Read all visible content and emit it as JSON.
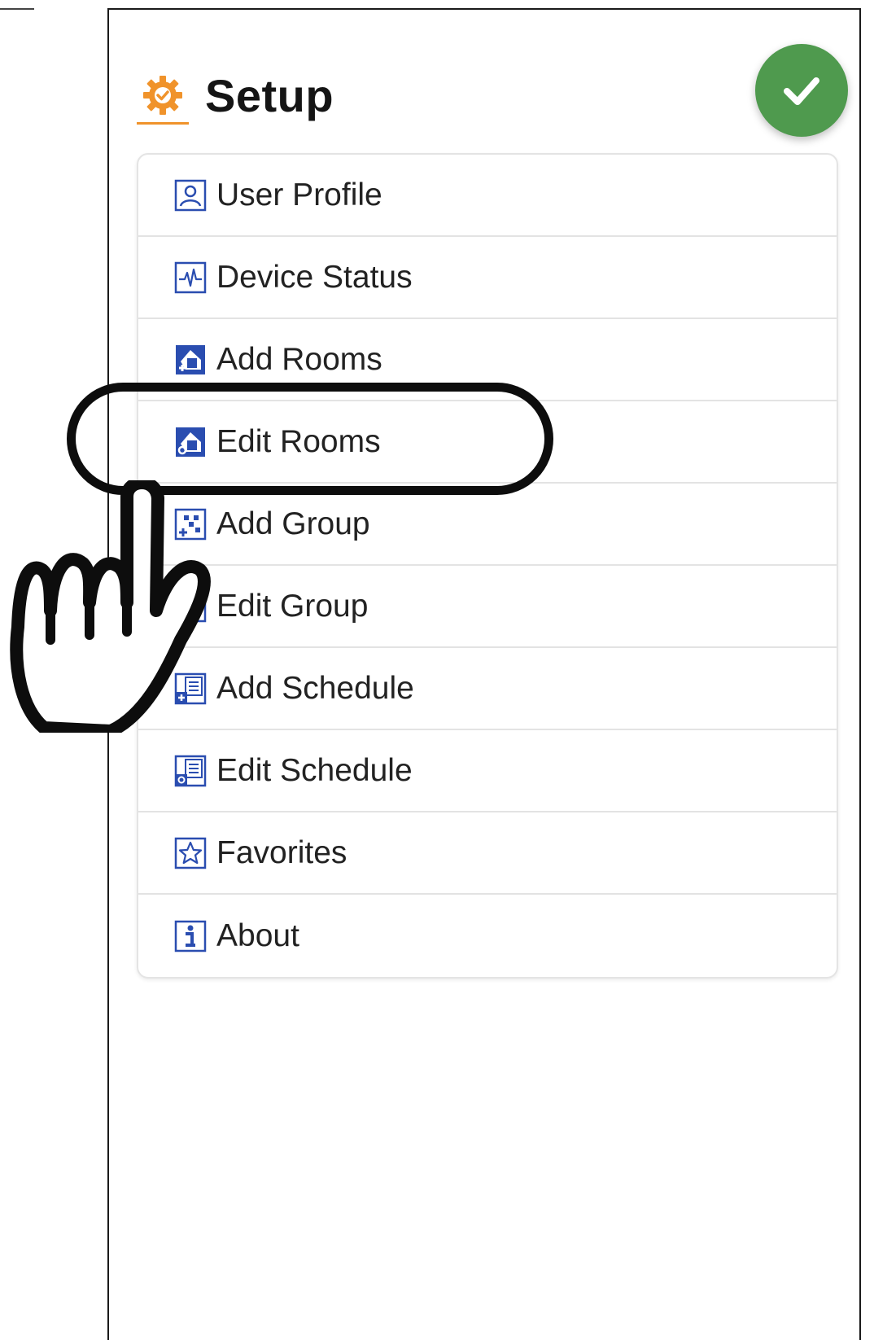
{
  "header": {
    "title": "Setup",
    "icon": "gear-check-icon",
    "accent_color": "#f0932b"
  },
  "done_button": {
    "icon": "check-icon",
    "color": "#4f9a4e"
  },
  "menu": {
    "items": [
      {
        "label": "User Profile",
        "icon": "user-profile-icon"
      },
      {
        "label": "Device Status",
        "icon": "device-status-icon"
      },
      {
        "label": "Add Rooms",
        "icon": "add-rooms-icon"
      },
      {
        "label": "Edit Rooms",
        "icon": "edit-rooms-icon"
      },
      {
        "label": "Add Group",
        "icon": "add-group-icon"
      },
      {
        "label": "Edit Group",
        "icon": "edit-group-icon"
      },
      {
        "label": "Add Schedule",
        "icon": "add-schedule-icon"
      },
      {
        "label": "Edit Schedule",
        "icon": "edit-schedule-icon"
      },
      {
        "label": "Favorites",
        "icon": "favorites-icon"
      },
      {
        "label": "About",
        "icon": "about-icon"
      }
    ],
    "highlighted_item": "Edit Rooms",
    "icon_color": "#2a4db0"
  },
  "annotation": {
    "pointer": "pointing-hand-icon"
  }
}
